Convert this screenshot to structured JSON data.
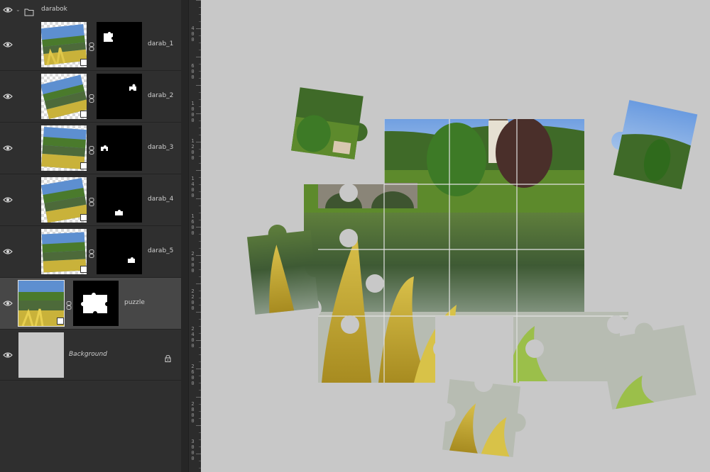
{
  "layers": {
    "group": {
      "name": "darabok",
      "icon": "folder-icon"
    },
    "items": [
      {
        "name": "darab_1"
      },
      {
        "name": "darab_2"
      },
      {
        "name": "darab_3"
      },
      {
        "name": "darab_4"
      },
      {
        "name": "darab_5"
      },
      {
        "name": "puzzle",
        "selected": true
      },
      {
        "name": "Background",
        "locked": true
      }
    ]
  },
  "ruler": {
    "labels": [
      "400",
      "600",
      "1000",
      "1200",
      "1400",
      "1600",
      "2000",
      "2200",
      "2400",
      "2600",
      "2800",
      "3000"
    ]
  },
  "colors": {
    "canvas": "#c8c8c8",
    "panel": "#2f2f2f",
    "selected_row": "#474747",
    "sky": "#5d8fd0",
    "grass": "#6e9a2e",
    "water": "#4d6a3a",
    "leaf_yellow": "#c9b23a"
  }
}
